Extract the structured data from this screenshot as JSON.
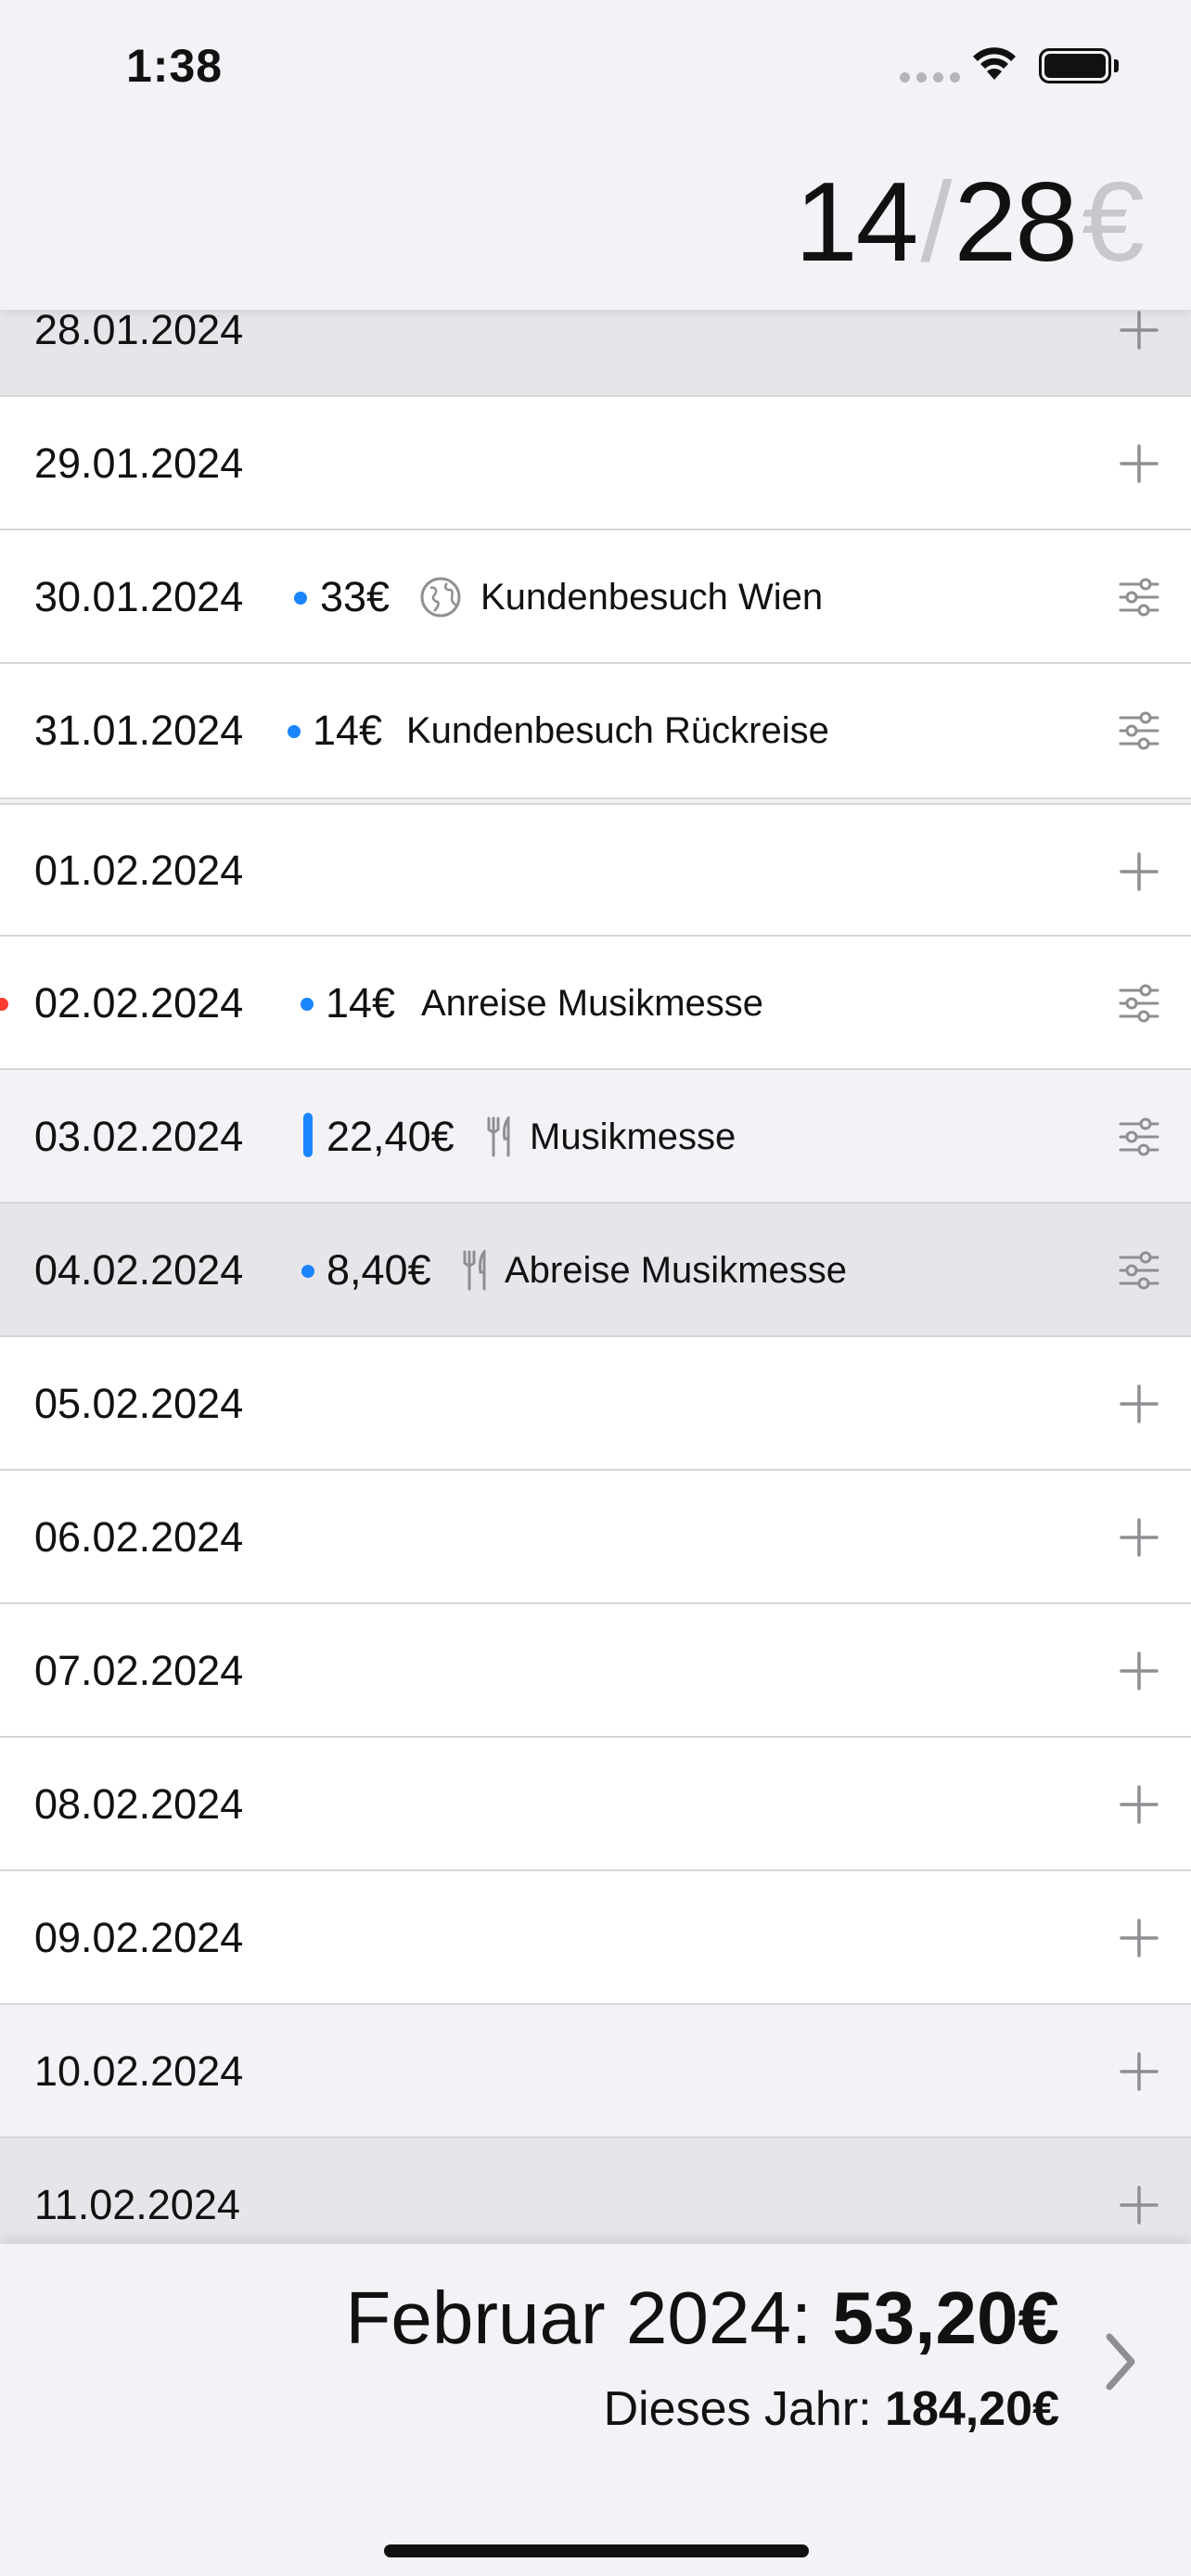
{
  "status_bar": {
    "time": "1:38"
  },
  "header": {
    "day": "14",
    "slash": "/",
    "days_total": "28",
    "currency": "€"
  },
  "colors": {
    "accent": "#1b84ff",
    "warning": "#ff3b30",
    "icon_gray": "#8e8e93"
  },
  "rows": [
    {
      "date": "28.01.2024",
      "action_icon": "plus-icon"
    },
    {
      "date": "29.01.2024",
      "action_icon": "plus-icon"
    },
    {
      "date": "30.01.2024",
      "amount": "33€",
      "category_icon": "globe-icon",
      "description": "Kundenbesuch Wien",
      "action_icon": "sliders-icon"
    },
    {
      "date": "31.01.2024",
      "amount": "14€",
      "description": "Kundenbesuch Rückreise",
      "action_icon": "sliders-icon"
    },
    {
      "date": "01.02.2024",
      "action_icon": "plus-icon"
    },
    {
      "date": "02.02.2024",
      "amount": "14€",
      "description": "Anreise Musikmesse",
      "action_icon": "sliders-icon"
    },
    {
      "date": "03.02.2024",
      "amount": "22,40€",
      "category_icon": "fork-knife-icon",
      "description": "Musikmesse",
      "action_icon": "sliders-icon"
    },
    {
      "date": "04.02.2024",
      "amount": "8,40€",
      "category_icon": "fork-knife-icon",
      "description": "Abreise Musikmesse",
      "action_icon": "sliders-icon"
    },
    {
      "date": "05.02.2024",
      "action_icon": "plus-icon"
    },
    {
      "date": "06.02.2024",
      "action_icon": "plus-icon"
    },
    {
      "date": "07.02.2024",
      "action_icon": "plus-icon"
    },
    {
      "date": "08.02.2024",
      "action_icon": "plus-icon"
    },
    {
      "date": "09.02.2024",
      "action_icon": "plus-icon"
    },
    {
      "date": "10.02.2024",
      "action_icon": "plus-icon"
    },
    {
      "date": "11.02.2024",
      "action_icon": "plus-icon"
    }
  ],
  "footer": {
    "month_label": "Februar 2024:",
    "month_total": "53,20€",
    "year_label": "Dieses Jahr:",
    "year_total": "184,20€",
    "next_icon": "chevron-right-icon"
  }
}
